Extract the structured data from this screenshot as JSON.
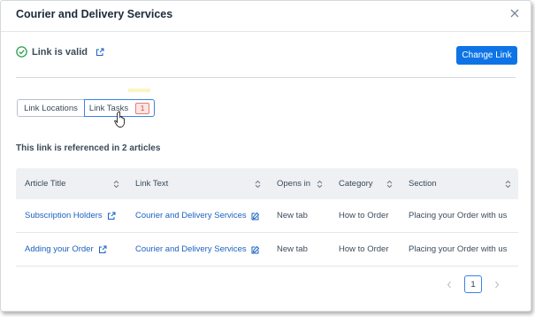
{
  "dialog": {
    "title": "Courier and Delivery Services",
    "close_icon": "close-icon"
  },
  "status": {
    "valid_text": "Link is valid",
    "valid_icon": "check-circle-icon",
    "external_icon": "external-link-icon",
    "color": "#2e9e4a"
  },
  "toolbar": {
    "change_link_label": "Change Link",
    "accent": "#0e74e6"
  },
  "tabs": [
    {
      "label": "Link Locations"
    },
    {
      "label": "Link Tasks",
      "badge": "1"
    }
  ],
  "reference_text": "This link is referenced in 2 articles",
  "table": {
    "columns": [
      "Article Title",
      "Link Text",
      "Opens in",
      "Category",
      "Section"
    ],
    "rows": [
      [
        "Subscription Holders",
        "Courier and Delivery Services",
        "New tab",
        "How to Order",
        "Placing your Order with us"
      ],
      [
        "Adding your Order",
        "Courier and Delivery Services",
        "New tab",
        "How to Order",
        "Placing your Order with us"
      ]
    ]
  },
  "pagination": {
    "current_page": "1"
  }
}
